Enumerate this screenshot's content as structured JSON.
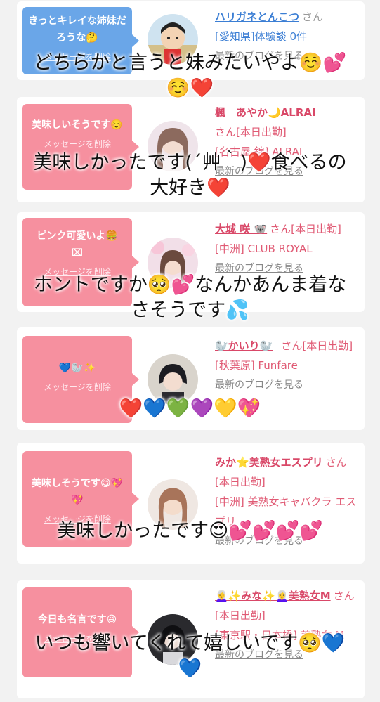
{
  "cards": [
    {
      "bubble_text": "きっとキレイな姉妹だろうな🤔",
      "delete_label": "メッセージを削除",
      "name": "ハリガネとんこつ",
      "honorific": "さん",
      "line2": "[愛知県]体験談 0件",
      "line3": "最新のブログを見る",
      "overlay": "どちらかと言うと妹みたいやよ☺️💕\n☺️❤️"
    },
    {
      "bubble_text": "美味しいそうです☺️",
      "delete_label": "メッセージを削除",
      "name": "楓　あやか🌙ALRAI",
      "honorific": "さん[本日出勤]",
      "line2": "[名古屋 錦] ALRAI",
      "line3": "最新のブログを見る",
      "overlay": "美味しかったです(´艸｀)❤️食べるの\n大好き❤️"
    },
    {
      "bubble_text": "ピンク可愛いよ🍔",
      "bubble_extra": "⌧",
      "delete_label": "メッセージを削除",
      "name": "大城 咲 🐨",
      "honorific": "さん[本日出勤]",
      "line2": "[中洲] CLUB ROYAL",
      "line3": "最新のブログを見る",
      "overlay": "ホントですか🥺💕なんかあんま着な\nさそうです💦"
    },
    {
      "bubble_text": "💙🦭✨",
      "delete_label": "メッセージを削除",
      "name": "🦭かいり🦭",
      "honorific": "さん[本日出勤]",
      "line2": "[秋葉原] Funfare",
      "line3": "最新のブログを見る",
      "overlay": "❤️💙💚💜💛💖"
    },
    {
      "bubble_text": "美味しそうです😋💖💖",
      "delete_label": "メッセージを削除",
      "name": "みか⭐美熟女エスプリ",
      "honorific": "さん[本日出勤]",
      "line2": "[中洲] 美熟女キャバクラ エスプリ",
      "line3": "最新のブログを見る",
      "overlay": "美味しかったです😍💕💕💕💕"
    },
    {
      "bubble_text": "今日も名言です😆",
      "delete_label": "メッセージを削除",
      "name": "👩‍🦳✨みな✨👩‍🦳美熟女M",
      "honorific": "さん[本日出勤]",
      "line2": "[東京駅・日本橋] 美熟女 M",
      "line3": "最新のブログを見る",
      "overlay": "いつも響いてくれて嬉しいです🥺💙\n💙"
    }
  ],
  "colors": {
    "accent_pink": "#f6909f",
    "accent_blue": "#6aa6e8",
    "name_pink": "#d94868",
    "name_blue": "#3b7ed4"
  }
}
